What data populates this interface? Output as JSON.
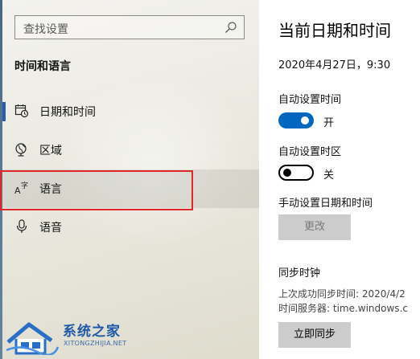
{
  "sidebar": {
    "search": {
      "placeholder": "查找设置",
      "icon": "search-icon"
    },
    "section_title": "时间和语言",
    "items": [
      {
        "label": "日期和时间",
        "icon": "calendar-clock-icon",
        "selected": true
      },
      {
        "label": "区域",
        "icon": "globe-region-icon",
        "selected": false
      },
      {
        "label": "语言",
        "icon": "language-icon",
        "selected": false,
        "highlighted": true
      },
      {
        "label": "语音",
        "icon": "microphone-icon",
        "selected": false
      }
    ]
  },
  "main": {
    "title": "当前日期和时间",
    "current_datetime": "2020年4月27日，9:30",
    "auto_time": {
      "label": "自动设置时间",
      "state_label": "开",
      "on": true
    },
    "auto_timezone": {
      "label": "自动设置时区",
      "state_label": "关",
      "on": false
    },
    "manual": {
      "label": "手动设置日期和时间",
      "button": "更改"
    },
    "sync": {
      "heading": "同步时钟",
      "last_sync": "上次成功同步时间: 2020/4/2",
      "server": "时间服务器: time.windows.c",
      "button": "立即同步"
    }
  },
  "watermark": {
    "title": "系统之家",
    "domain": "XITONGZHIJIA.NET"
  },
  "colors": {
    "accent": "#0067c0",
    "highlight_border": "#e0262a",
    "selected_indicator": "#2b5ea8"
  }
}
